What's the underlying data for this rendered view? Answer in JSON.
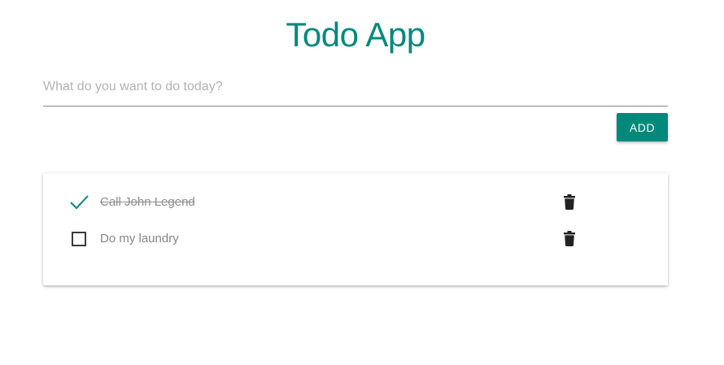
{
  "header": {
    "title": "Todo App"
  },
  "new_todo": {
    "value": "",
    "placeholder": "What do you want to do today?",
    "add_label": "ADD"
  },
  "todos": [
    {
      "label": "Call John Legend",
      "completed": true,
      "check_icon": "checkmark-icon",
      "delete_icon": "trash-icon"
    },
    {
      "label": "Do my laundry",
      "completed": false,
      "check_icon": "checkbox-empty-icon",
      "delete_icon": "trash-icon"
    }
  ],
  "colors": {
    "accent": "#00897b",
    "text_muted": "#858585",
    "icon_dark": "#222222"
  }
}
